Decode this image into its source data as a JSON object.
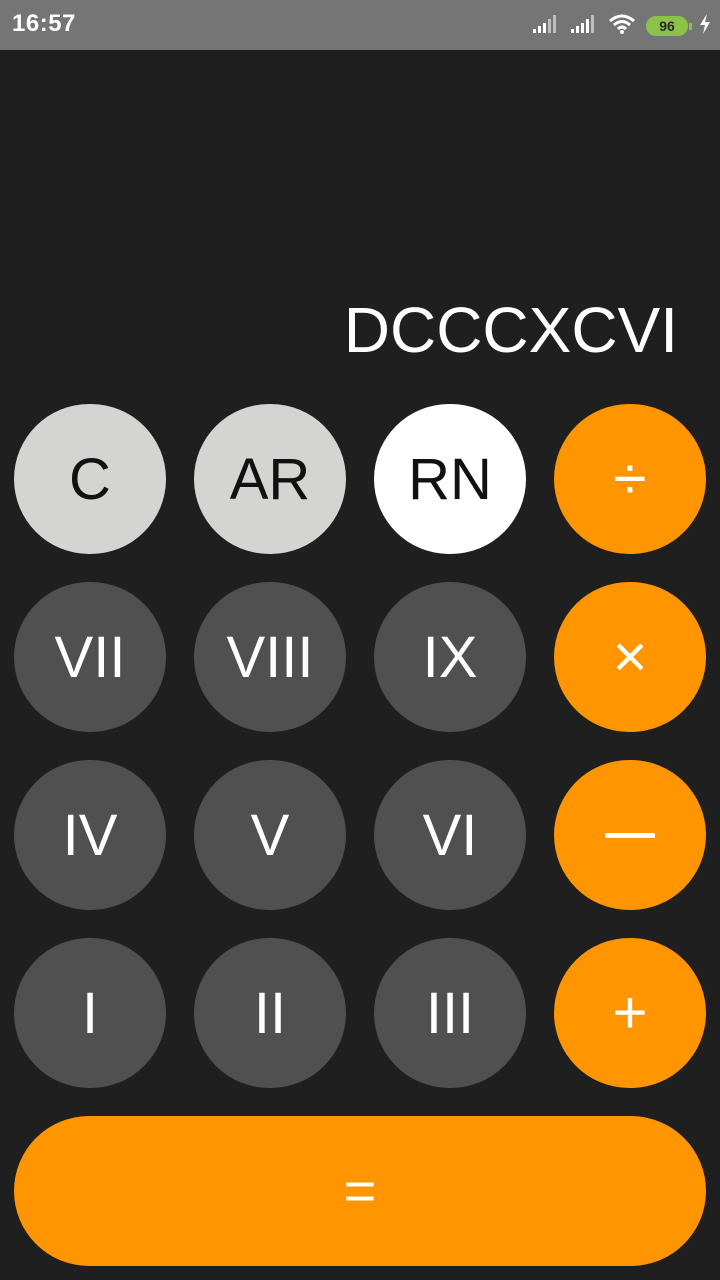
{
  "status_bar": {
    "time": "16:57",
    "battery_level": "96",
    "icons": [
      "signal-icon",
      "signal-icon",
      "wifi-icon",
      "battery-icon",
      "charging-icon"
    ],
    "battery_color": "#8bc34a"
  },
  "display": {
    "value": "DCCCXCVI"
  },
  "keys": {
    "clear": "C",
    "ar": "AR",
    "rn": "RN",
    "divide": "÷",
    "seven": "VII",
    "eight": "VIII",
    "nine": "IX",
    "multiply": "×",
    "four": "IV",
    "five": "V",
    "six": "VI",
    "minus": "—",
    "one": "I",
    "two": "II",
    "three": "III",
    "plus": "+",
    "equals": "="
  },
  "colors": {
    "background": "#1f1f1f",
    "status_bar": "#757575",
    "operator": "#ff9500",
    "digit": "#505050",
    "function": "#d4d4d2",
    "active_mode": "#ffffff"
  }
}
